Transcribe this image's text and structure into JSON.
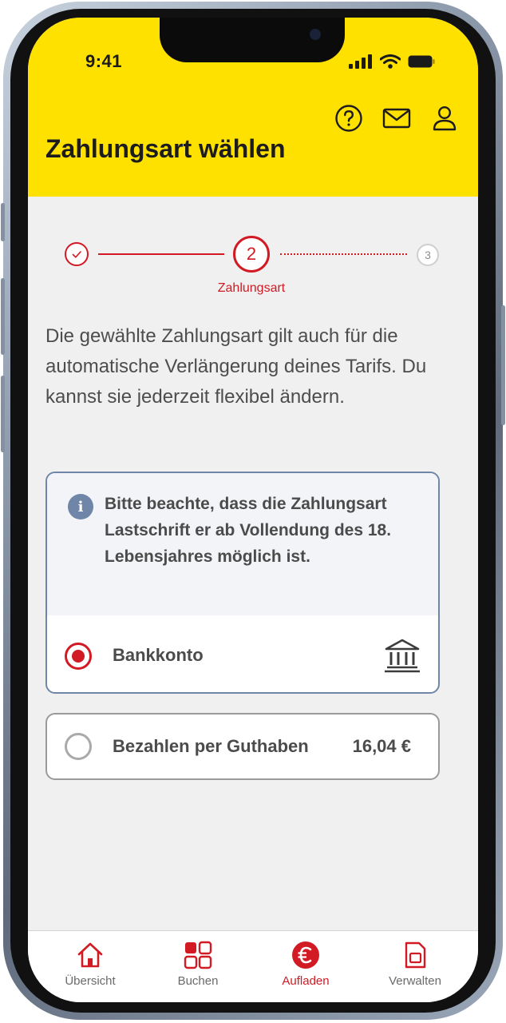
{
  "status_bar": {
    "time": "9:41"
  },
  "header": {
    "title": "Zahlungsart wählen",
    "icons": [
      "help-icon",
      "mail-icon",
      "profile-icon"
    ]
  },
  "stepper": {
    "steps": [
      {
        "number": "1",
        "state": "done"
      },
      {
        "number": "2",
        "state": "active",
        "label": "Zahlungsart"
      },
      {
        "number": "3",
        "state": "upcoming"
      }
    ]
  },
  "description": "Die gewählte Zahlungsart gilt auch für die automatische Verlängerung deines Tarifs. Du kannst sie jederzeit flexibel ändern.",
  "payment_options": {
    "info": "Bitte beachte, dass die Zahlungsart Lastschrift er ab Vollendung des 18. Lebensjahres möglich ist.",
    "bank": {
      "label": "Bankkonto",
      "selected": true,
      "icon": "bank-icon"
    },
    "guthaben": {
      "label": "Bezahlen per Guthaben",
      "amount": "16,04 €",
      "selected": false
    }
  },
  "tabbar": {
    "tabs": [
      {
        "label": "Übersicht",
        "icon": "home-icon",
        "active": false
      },
      {
        "label": "Buchen",
        "icon": "grid-icon",
        "active": false
      },
      {
        "label": "Aufladen",
        "icon": "euro-icon",
        "active": true
      },
      {
        "label": "Verwalten",
        "icon": "sim-card-icon",
        "active": false
      }
    ]
  },
  "colors": {
    "header_yellow": "#ffe100",
    "accent_red": "#d11a23",
    "info_blue": "#6f86a8",
    "background": "#f0f0f0"
  }
}
